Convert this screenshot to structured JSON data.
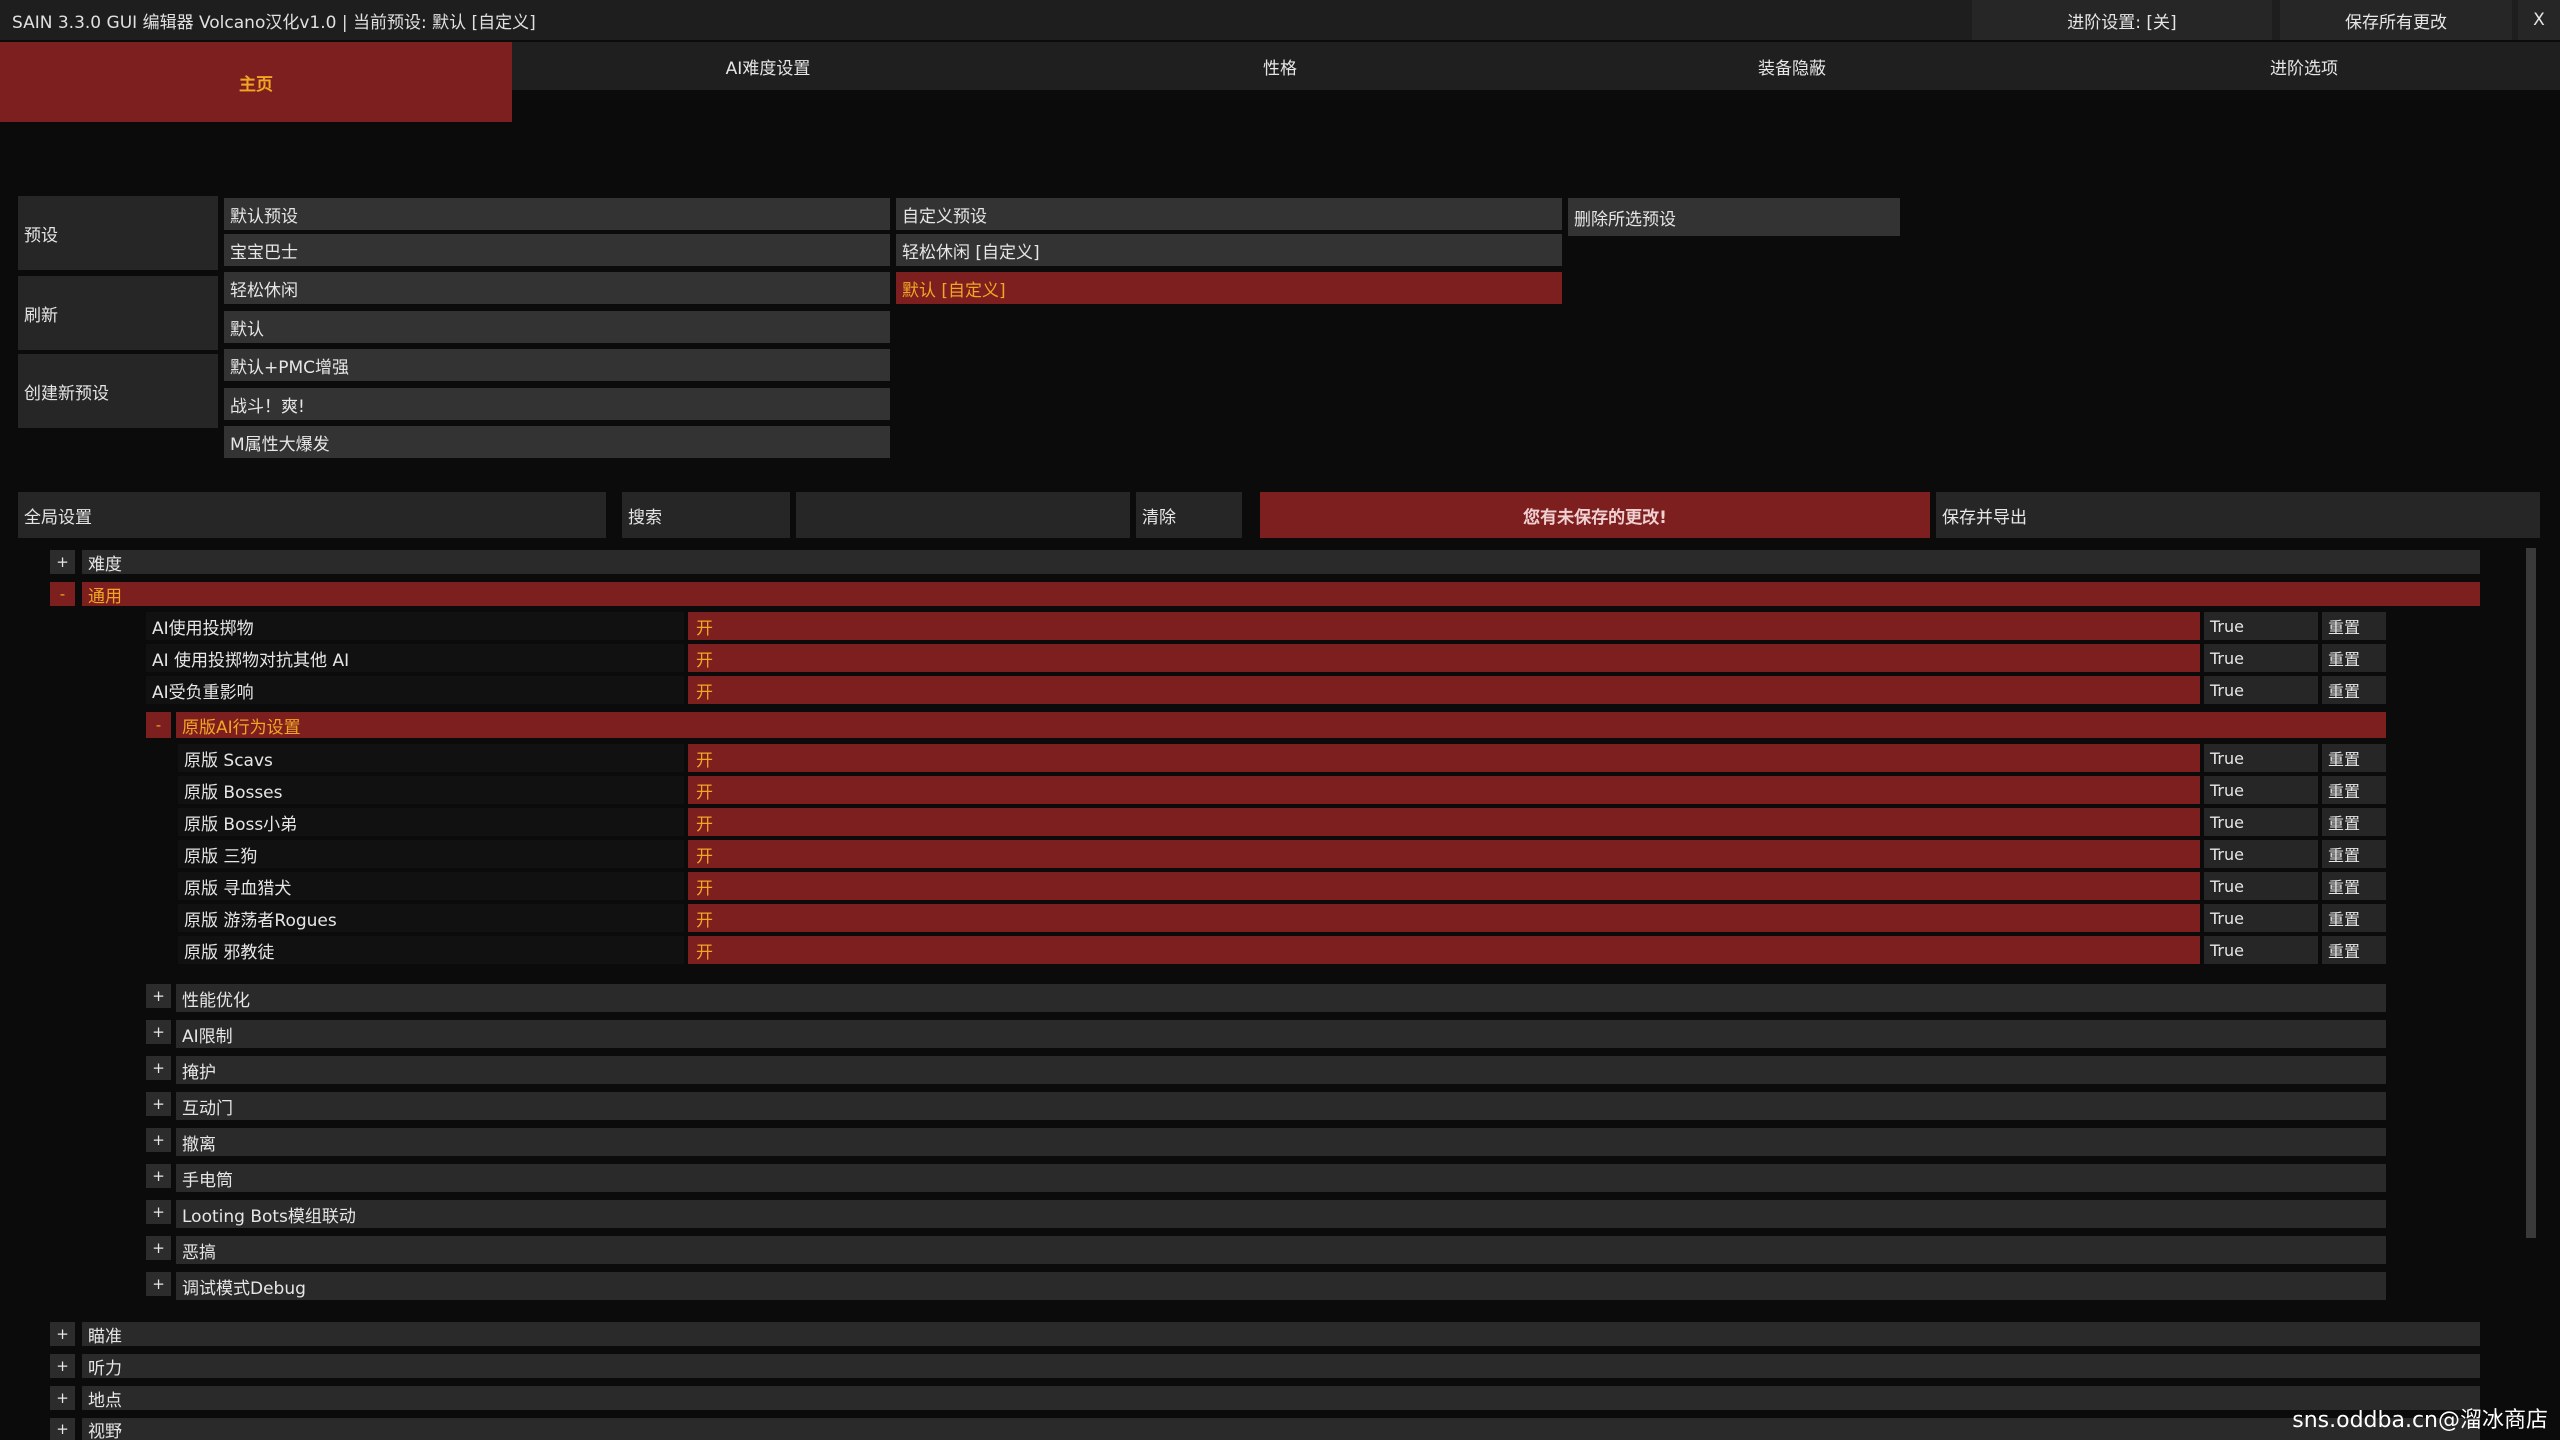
{
  "title": "SAIN 3.3.0 GUI 编辑器  Volcano汉化v1.0 | 当前预设: 默认 [自定义]",
  "topbar": {
    "advanced_label": "进阶设置: [关]",
    "save_all_label": "保存所有更改",
    "close_label": "X"
  },
  "tabs": [
    "主页",
    "AI难度设置",
    "性格",
    "装备隐蔽",
    "进阶选项"
  ],
  "presets": {
    "left_buttons": [
      "预设",
      "刷新",
      "创建新预设"
    ],
    "builtin": [
      "默认预设",
      "宝宝巴士",
      "轻松休闲",
      "默认",
      "默认+PMC增强",
      "战斗！爽!",
      "M属性大爆发"
    ],
    "custom": [
      "自定义预设",
      "轻松休闲 [自定义]",
      "默认 [自定义]"
    ],
    "delete_label": "删除所选预设"
  },
  "toolbar": {
    "global_label": "全局设置",
    "search_label": "搜索",
    "search_value": "",
    "clear_label": "清除",
    "unsaved_label": "您有未保存的更改!",
    "save_export_label": "保存并导出"
  },
  "tree": {
    "expand": "+",
    "collapse": "-",
    "difficulty": "难度",
    "general": "通用",
    "general_rows": [
      {
        "label": "AI使用投掷物",
        "value": "开",
        "bool": "True",
        "reset": "重置"
      },
      {
        "label": "AI 使用投掷物对抗其他 AI",
        "value": "开",
        "bool": "True",
        "reset": "重置"
      },
      {
        "label": "AI受负重影响",
        "value": "开",
        "bool": "True",
        "reset": "重置"
      }
    ],
    "vanilla_header": "原版AI行为设置",
    "vanilla_rows": [
      {
        "label": "原版 Scavs",
        "value": "开",
        "bool": "True",
        "reset": "重置"
      },
      {
        "label": "原版 Bosses",
        "value": "开",
        "bool": "True",
        "reset": "重置"
      },
      {
        "label": "原版 Boss小弟",
        "value": "开",
        "bool": "True",
        "reset": "重置"
      },
      {
        "label": "原版 三狗",
        "value": "开",
        "bool": "True",
        "reset": "重置"
      },
      {
        "label": "原版 寻血猎犬",
        "value": "开",
        "bool": "True",
        "reset": "重置"
      },
      {
        "label": "原版 游荡者Rogues",
        "value": "开",
        "bool": "True",
        "reset": "重置"
      },
      {
        "label": "原版 邪教徒",
        "value": "开",
        "bool": "True",
        "reset": "重置"
      }
    ],
    "sub_sections": [
      "性能优化",
      "AI限制",
      "掩护",
      "互动门",
      "撤离",
      "手电筒",
      "Looting Bots模组联动",
      "恶搞",
      "调试模式Debug"
    ],
    "bottom_sections": [
      "瞄准",
      "听力",
      "地点",
      "视野"
    ]
  },
  "watermark": "sns.oddba.cn@溜冰商店",
  "colors": {
    "accent_red": "#7d1f1f",
    "accent_orange": "#f2a623",
    "background": "#0b0b0b"
  }
}
